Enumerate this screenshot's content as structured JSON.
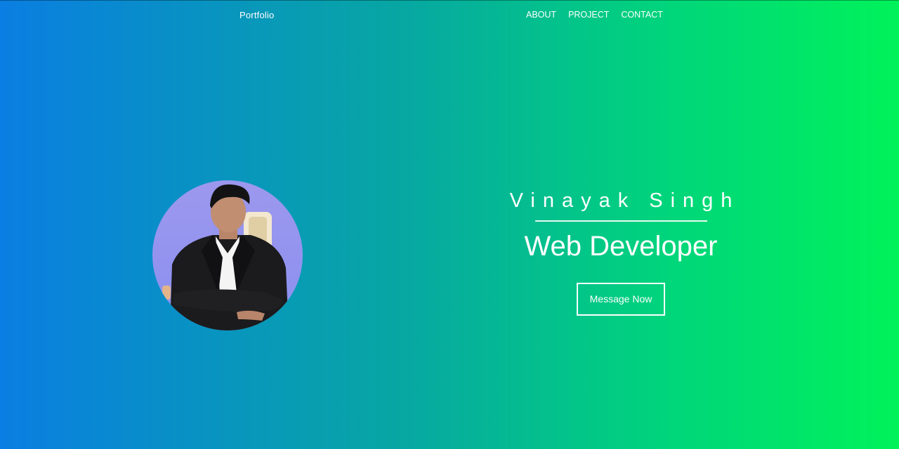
{
  "nav": {
    "brand": "Portfolio",
    "links": [
      "ABOUT",
      "PROJECT",
      "CONTACT"
    ]
  },
  "hero": {
    "name": "Vinayak Singh",
    "role": "Web Developer",
    "cta_label": "Message Now"
  },
  "colors": {
    "gradient_start": "#0a7ee2",
    "gradient_mid": "#07a7a2",
    "gradient_end": "#00f25a",
    "text": "#ffffff"
  },
  "icons": {
    "avatar": "profile-photo"
  }
}
